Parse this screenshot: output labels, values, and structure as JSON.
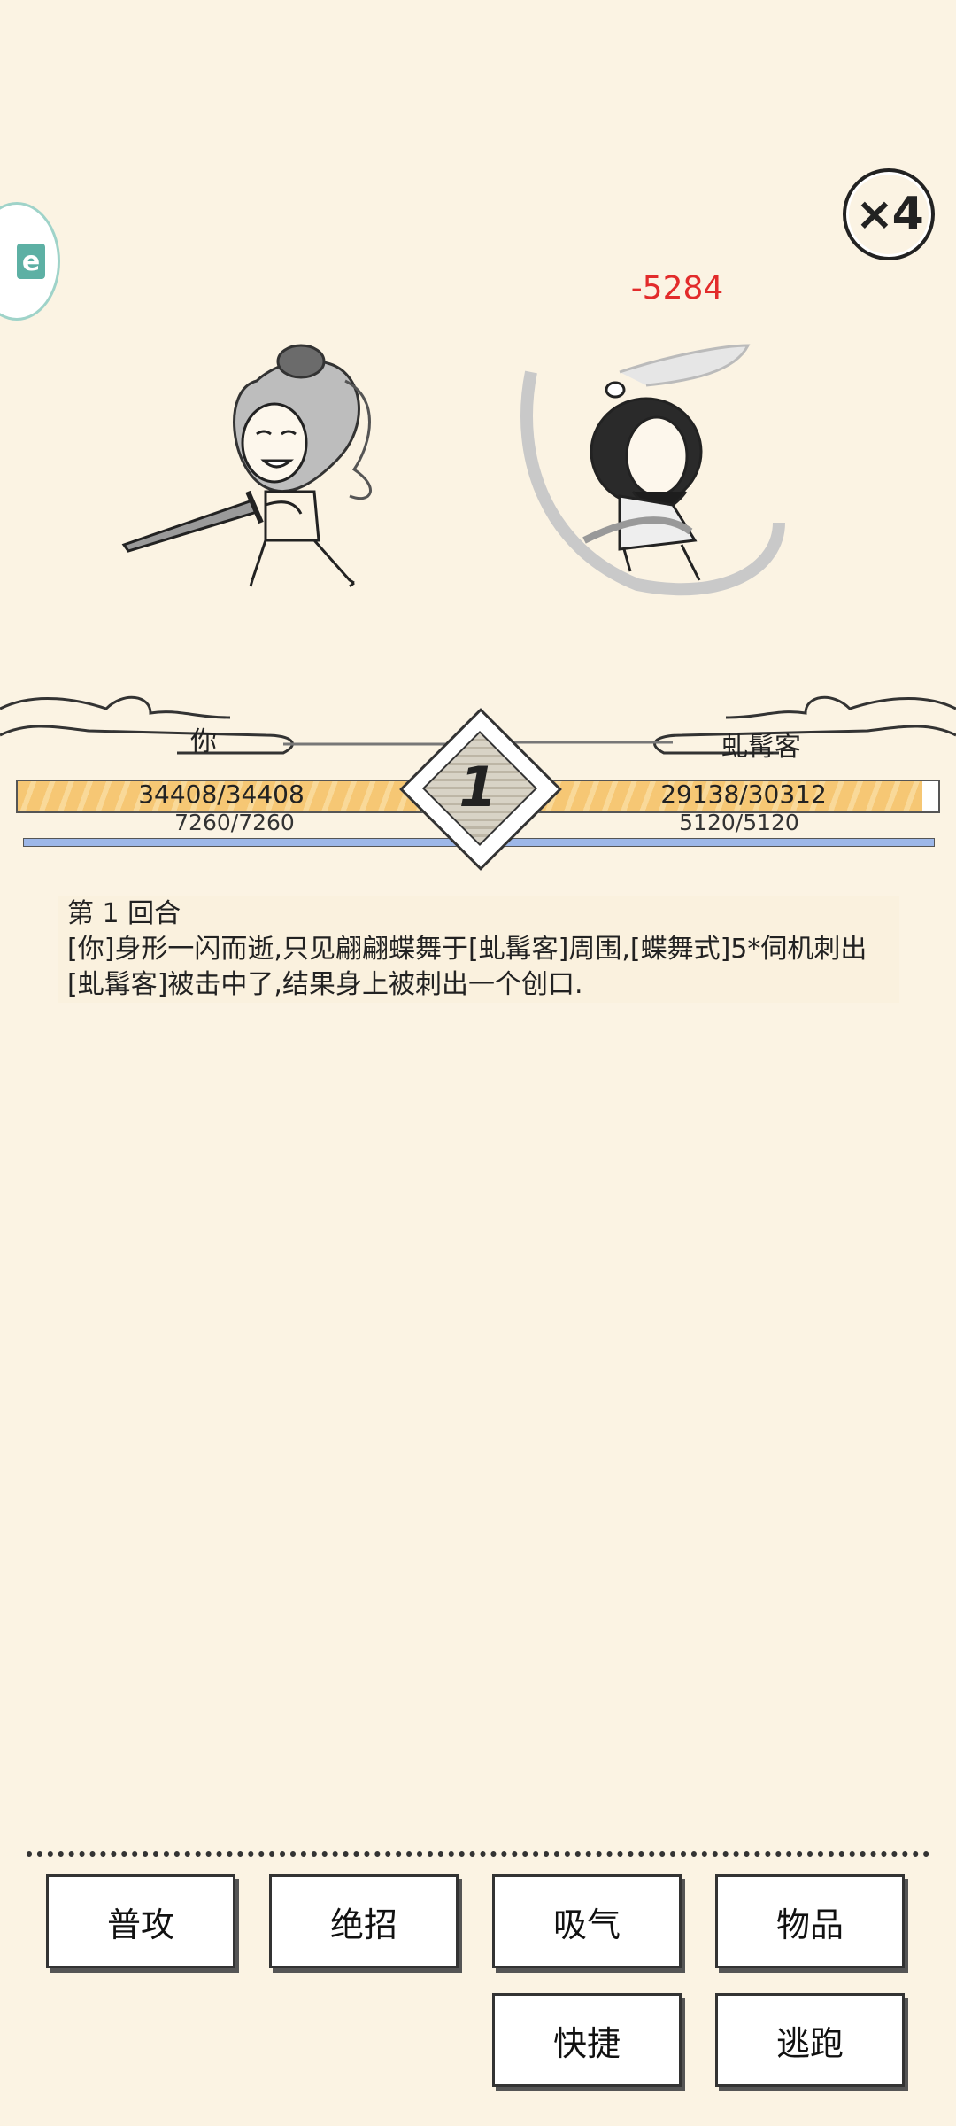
{
  "speed_label": "×4",
  "side_float_label": "e",
  "damage": "-5284",
  "round_number": "1",
  "player": {
    "name": "你",
    "hp": "34408/34408",
    "mp": "7260/7260",
    "hp_fraction": 1.0,
    "mp_fraction": 1.0
  },
  "enemy": {
    "name": "虬髯客",
    "hp": "29138/30312",
    "mp": "5120/5120",
    "hp_fraction": 0.961,
    "mp_fraction": 1.0
  },
  "log": {
    "round": "第 1 回合",
    "lines": [
      "[你]身形一闪而逝,只见翩翩蝶舞于[虬髯客]周围,[蝶舞式]5*伺机刺出",
      "[虬髯客]被击中了,结果身上被刺出一个创口."
    ]
  },
  "actions": {
    "normal_attack": "普攻",
    "ultimate": "绝招",
    "breathe": "吸气",
    "items": "物品",
    "shortcut": "快捷",
    "flee": "逃跑"
  },
  "colors": {
    "hp_bar": "#f6c774",
    "mp_bar": "#9db7e8",
    "damage": "#e22b2b",
    "background": "#fbf3e3"
  }
}
